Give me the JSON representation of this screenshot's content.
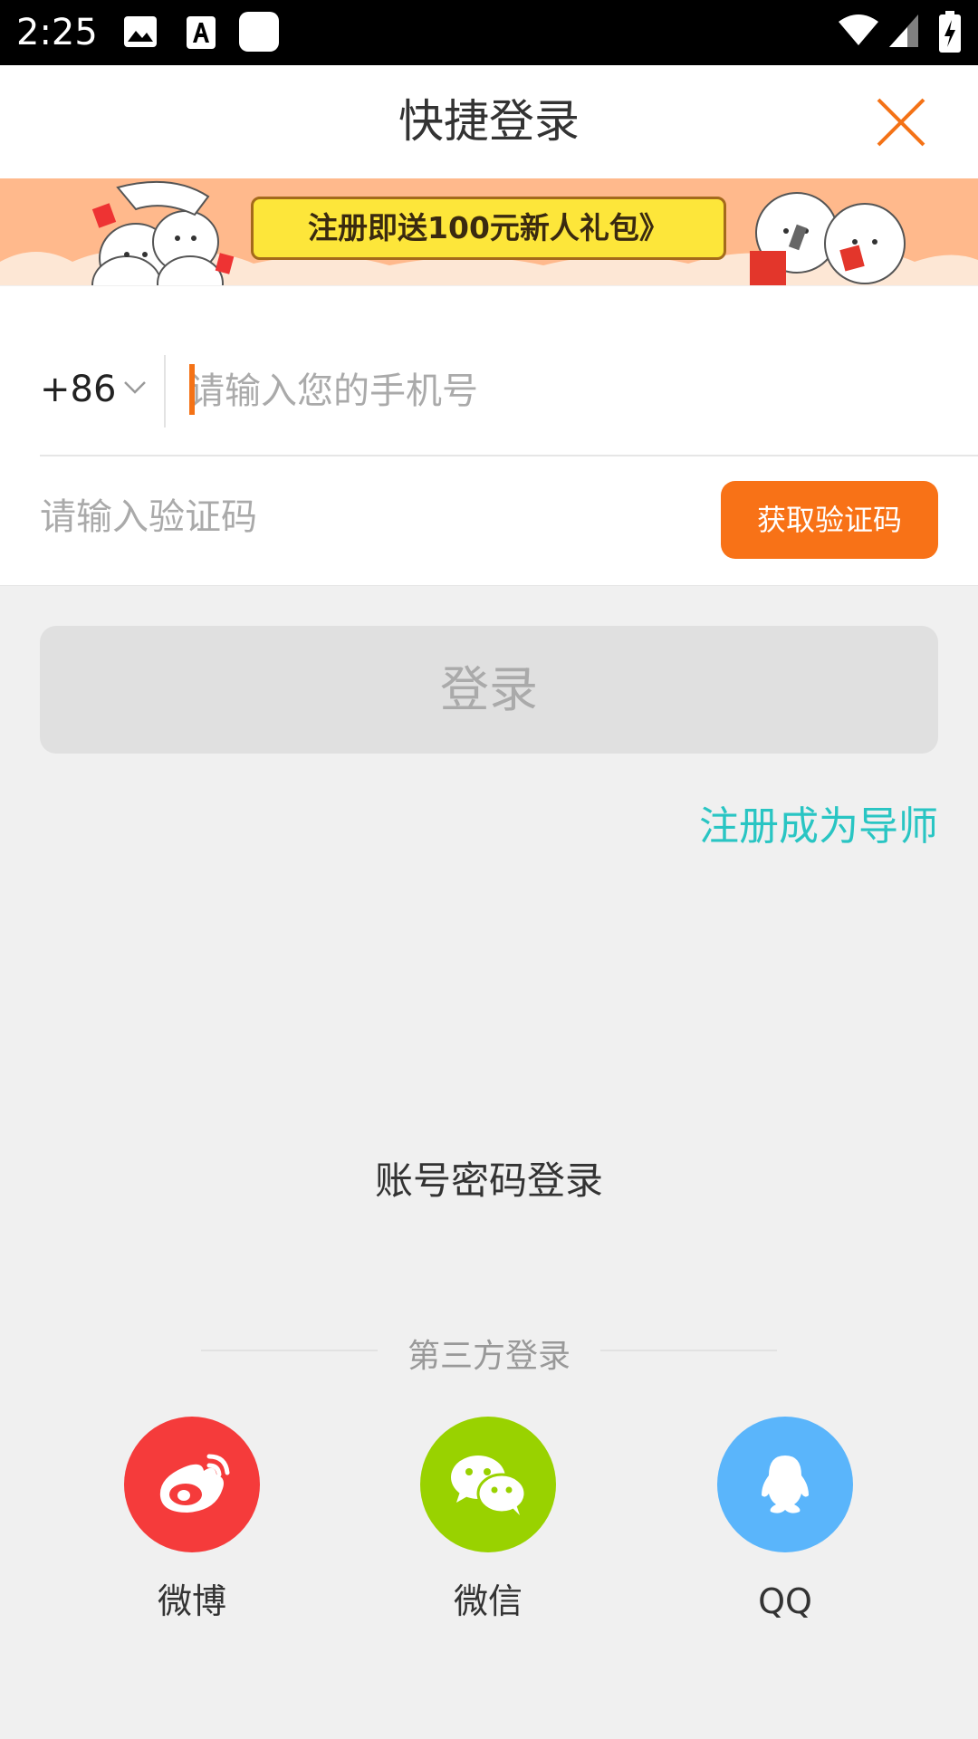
{
  "status_bar": {
    "time": "2:25"
  },
  "header": {
    "title": "快捷登录"
  },
  "banner": {
    "cta_label": "注册即送100元新人礼包》"
  },
  "form": {
    "country_code": "+86",
    "phone_placeholder": "请输入您的手机号",
    "code_placeholder": "请输入验证码",
    "get_code_label": "获取验证码"
  },
  "login_label": "登录",
  "register_link": "注册成为导师",
  "password_login": "账号密码登录",
  "third_party": {
    "title": "第三方登录",
    "items": [
      {
        "label": "微博",
        "icon": "weibo-icon",
        "color": "#f53b3b"
      },
      {
        "label": "微信",
        "icon": "wechat-icon",
        "color": "#99d200"
      },
      {
        "label": "QQ",
        "icon": "qq-icon",
        "color": "#5ab5fb"
      }
    ]
  },
  "colors": {
    "accent": "#f87217",
    "link": "#29c5c3"
  }
}
